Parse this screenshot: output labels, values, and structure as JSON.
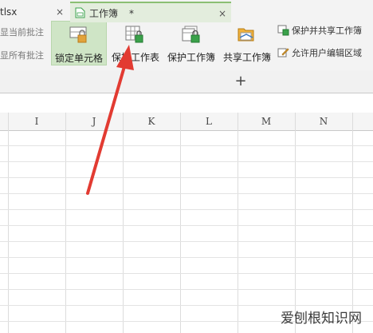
{
  "review": {
    "current_comment": "显当前批注",
    "all_comments": "显所有批注"
  },
  "protect": {
    "lock_cell": "锁定单元格",
    "protect_sheet": "保护工作表",
    "protect_book": "保护工作簿",
    "share_book": "共享工作簿",
    "protect_share": "保护并共享工作簿",
    "allow_edit": "允许用户编辑区域"
  },
  "tabs": {
    "inactive_label": "tlsx",
    "active_label": "工作簿",
    "active_modified": "*",
    "close": "×",
    "add": "+"
  },
  "columns": [
    "I",
    "J",
    "K",
    "L",
    "M",
    "N"
  ],
  "watermark": "爱刨根知识网",
  "colors": {
    "accent": "#cfe5c6",
    "tab_active": "#e3eddd",
    "arrow": "#e23b32"
  }
}
